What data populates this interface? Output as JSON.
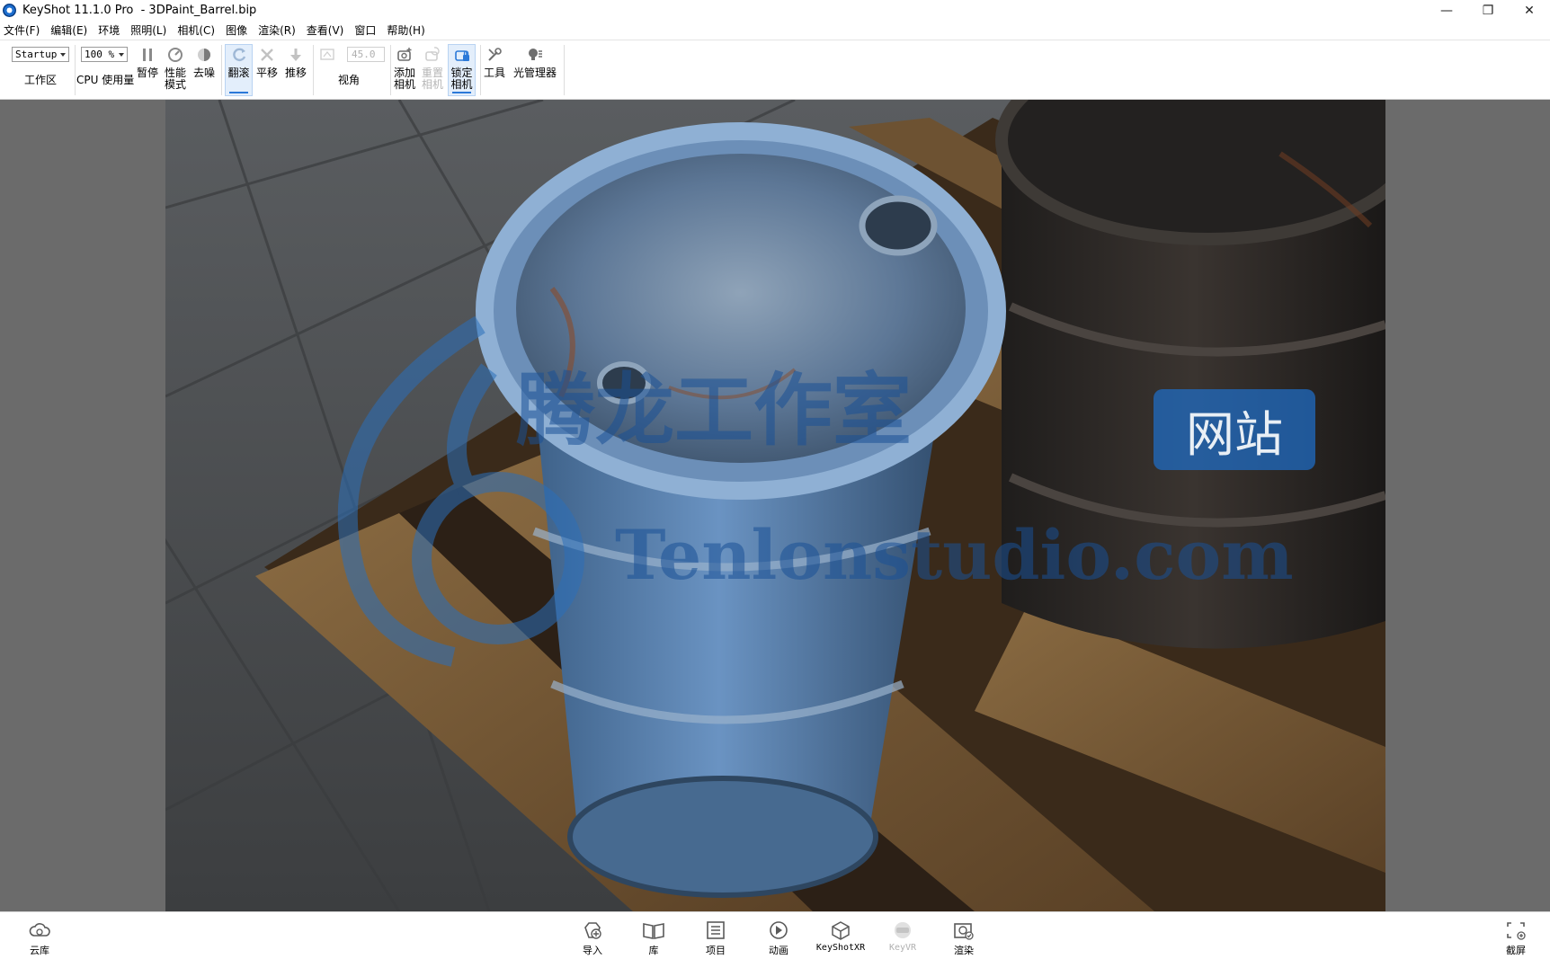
{
  "window": {
    "title": "KeyShot 11.1.0 Pro  - 3DPaint_Barrel.bip",
    "controls": {
      "minimize": "—",
      "restore": "❐",
      "close": "✕"
    }
  },
  "menu": [
    "文件(F)",
    "编辑(E)",
    "环境",
    "照明(L)",
    "相机(C)",
    "图像",
    "渲染(R)",
    "查看(V)",
    "窗口",
    "帮助(H)"
  ],
  "toolbar": {
    "workspace_value": "Startup",
    "workspace_label": "工作区",
    "cpu_value": "100 %",
    "cpu_label": "CPU 使用量",
    "pause_label": "暂停",
    "perf_label": "性能\n模式",
    "denoise_label": "去噪",
    "tumble_label": "翻滚",
    "pan_label": "平移",
    "dolly_label": "推移",
    "fov_value": "45.0",
    "fov_label": "视角",
    "add_camera_label": "添加\n相机",
    "reset_camera_label": "重置\n相机",
    "lock_camera_label": "锁定\n相机",
    "tools_label": "工具",
    "light_manager_label": "光管理器"
  },
  "watermark": {
    "line1": "腾龙工作室",
    "badge": "网站",
    "line2": "Tenlonstudio.com"
  },
  "bottombar": {
    "cloud_label": "云库",
    "import_label": "导入",
    "library_label": "库",
    "project_label": "项目",
    "animation_label": "动画",
    "keyshotxr_label": "KeyShotXR",
    "keyvr_label": "KeyVR",
    "render_label": "渲染",
    "screenshot_label": "截屏"
  }
}
